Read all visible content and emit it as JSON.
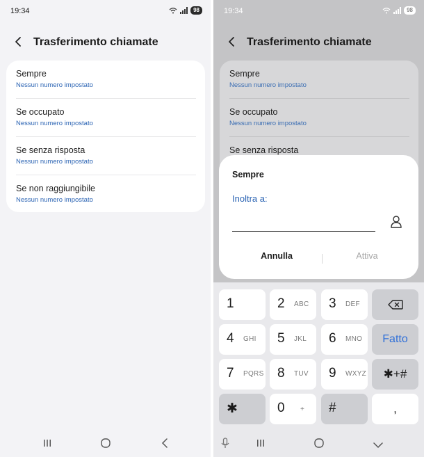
{
  "status": {
    "time": "19:34",
    "battery": "98"
  },
  "header": {
    "title": "Trasferimento chiamate"
  },
  "items": [
    {
      "title": "Sempre",
      "subtitle": "Nessun numero impostato"
    },
    {
      "title": "Se occupato",
      "subtitle": "Nessun numero impostato"
    },
    {
      "title": "Se senza risposta",
      "subtitle": "Nessun numero impostato"
    },
    {
      "title": "Se non raggiungibile",
      "subtitle": "Nessun numero impostato"
    }
  ],
  "dialog": {
    "title": "Sempre",
    "label": "Inoltra a:",
    "input_value": "",
    "cancel": "Annulla",
    "activate": "Attiva"
  },
  "keypad": {
    "keys": [
      {
        "num": "1",
        "letters": ""
      },
      {
        "num": "2",
        "letters": "ABC"
      },
      {
        "num": "3",
        "letters": "DEF"
      },
      {
        "num": "4",
        "letters": "GHI"
      },
      {
        "num": "5",
        "letters": "JKL"
      },
      {
        "num": "6",
        "letters": "MNO"
      },
      {
        "num": "7",
        "letters": "PQRS"
      },
      {
        "num": "8",
        "letters": "TUV"
      },
      {
        "num": "9",
        "letters": "WXYZ"
      },
      {
        "num": "0",
        "letters": "+"
      }
    ],
    "done": "Fatto",
    "star": "✱",
    "hash": "#",
    "comma": ",",
    "symbols": "✱+#"
  },
  "colors": {
    "accent": "#2a63b3",
    "dim_overlay": "#c4c4c6"
  }
}
